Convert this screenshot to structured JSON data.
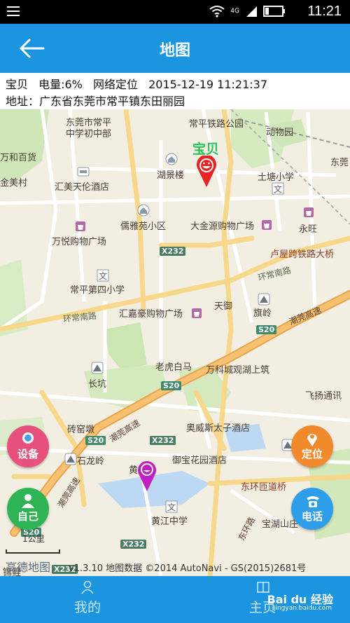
{
  "status_bar": {
    "time": "11:21",
    "network": "4G"
  },
  "header": {
    "title": "地图",
    "back_icon": "back-arrow-icon"
  },
  "info": {
    "name": "宝贝",
    "battery": "电量:6%",
    "locate_mode": "网络定位",
    "timestamp": "2015-12-19 11:21:37",
    "address": "地址：广东省东莞市常平镇东田丽园"
  },
  "map": {
    "pois": [
      {
        "name": "东莞市常平",
        "style": "poi"
      },
      {
        "name": "中学初中部",
        "style": "poi"
      },
      {
        "name": "常平铁路公园",
        "style": "poi"
      },
      {
        "name": "动物园",
        "style": "poi"
      },
      {
        "name": "万和百货",
        "style": "poi"
      },
      {
        "name": "湖景楼",
        "style": "poi"
      },
      {
        "name": "土塘小学",
        "style": "poi"
      },
      {
        "name": "东莞",
        "style": "poi"
      },
      {
        "name": "金美村",
        "style": "poi"
      },
      {
        "name": "汇美天伦酒店",
        "style": "poi"
      },
      {
        "name": "儒雅苑小区",
        "style": "poi"
      },
      {
        "name": "大金源购物广场",
        "style": "poi"
      },
      {
        "name": "永旺",
        "style": "poi"
      },
      {
        "name": "万悦购物广场",
        "style": "poi"
      },
      {
        "name": "卢屋跨铁路大桥",
        "style": "brown"
      },
      {
        "name": "常平第四小学",
        "style": "poi"
      },
      {
        "name": "汇嘉豪购物广场",
        "style": "poi"
      },
      {
        "name": "天御",
        "style": "poi"
      },
      {
        "name": "旗岭",
        "style": "poi"
      },
      {
        "name": "老虎白马",
        "style": "poi"
      },
      {
        "name": "万科城观湖上筑",
        "style": "poi"
      },
      {
        "name": "长坑",
        "style": "poi"
      },
      {
        "name": "飞扬通讯",
        "style": "poi"
      },
      {
        "name": "砖窑墩",
        "style": "poi"
      },
      {
        "name": "奥威斯太子酒店",
        "style": "poi"
      },
      {
        "name": "石龙岭",
        "style": "poi"
      },
      {
        "name": "御宝花园酒店",
        "style": "poi"
      },
      {
        "name": "东环匝道桥",
        "style": "brown"
      },
      {
        "name": "黄江中学",
        "style": "poi"
      },
      {
        "name": "宝湖山庄",
        "style": "poi"
      },
      {
        "name": "黄",
        "style": "poi"
      },
      {
        "name": "锦鲤",
        "style": "poi"
      }
    ],
    "roads": [
      {
        "name": "环常南路",
        "style": "gray"
      },
      {
        "name": "环常南路",
        "style": "gray"
      },
      {
        "name": "常平铁路公园",
        "style": "gray"
      },
      {
        "name": "潮莞高速",
        "style": "brown"
      },
      {
        "name": "潮莞高速",
        "style": "brown"
      },
      {
        "name": "潮莞高速",
        "style": "brown"
      },
      {
        "name": "东环路",
        "style": "brown"
      }
    ],
    "badges": [
      "X232",
      "S20",
      "S20",
      "X232",
      "S20",
      "X232",
      "S20",
      "X232"
    ],
    "baby_label": "宝贝",
    "scale": "1公里",
    "logo": "高德地图",
    "attribution": "v1.3.10 地图数据 ©2014 AutoNavi - GS(2015)2681号"
  },
  "buttons": {
    "device": "设备",
    "locate": "定位",
    "self": "自己",
    "phone": "电话"
  },
  "bottom_nav": {
    "mine": "我的",
    "home": "主页"
  },
  "watermark": {
    "text": "Bai du 经验",
    "sub": "jingyan.baidu.com"
  },
  "colors": {
    "accent": "#1b95e0",
    "device_btn": "#e8517d",
    "locate_btn": "#f08a2c",
    "self_btn": "#2fb455",
    "phone_btn": "#2f9ee8",
    "baby_pin": "#e82323",
    "device_pin": "#c21ec2"
  }
}
